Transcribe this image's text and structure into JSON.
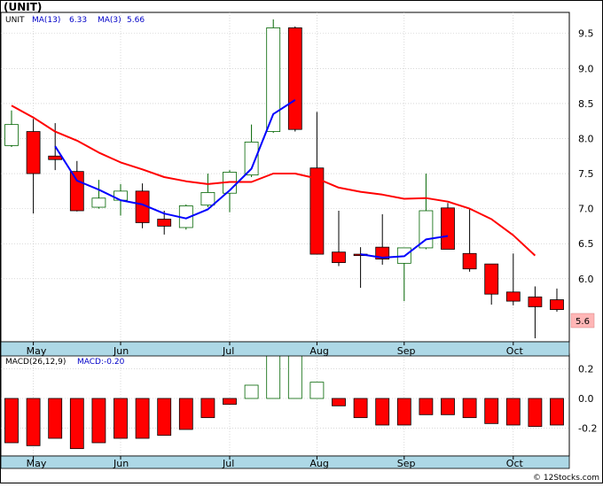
{
  "header": {
    "title": "(UNIT)"
  },
  "legend": {
    "symbol": "UNIT",
    "ma13_label": "MA(13)",
    "ma13_value": "6.33",
    "ma3_label": "MA(3)",
    "ma3_value": "5.66"
  },
  "macd_legend": {
    "label": "MACD(26,12,9)",
    "value_label": "MACD:-0.20"
  },
  "last_price_label": "5.6",
  "footer": {
    "copyright": "© 12Stocks.com"
  },
  "colors": {
    "up_candle": "#006400",
    "down_candle": "#ff0000",
    "ma3": "#0000ff",
    "ma13": "#ff0000",
    "axis_strip": "#add8e6",
    "grid": "#c0c0c0",
    "last_price_bg": "#ffb6b6"
  },
  "chart_data": [
    {
      "type": "candlestick",
      "title": "UNIT",
      "ylim": [
        5.1,
        9.8
      ],
      "yticks": [
        "6.0",
        "6.5",
        "7.0",
        "7.5",
        "8.0",
        "8.5",
        "9.0",
        "9.5"
      ],
      "xticks": [
        "May",
        "Jun",
        "Jul",
        "Aug",
        "Sep",
        "Oct"
      ],
      "xtick_index": [
        1,
        5,
        10,
        14,
        18,
        23
      ],
      "grid": true,
      "candles": [
        {
          "o": 7.9,
          "h": 8.4,
          "l": 7.88,
          "c": 8.2
        },
        {
          "o": 8.1,
          "h": 8.28,
          "l": 6.93,
          "c": 7.5
        },
        {
          "o": 7.75,
          "h": 8.22,
          "l": 7.55,
          "c": 7.7
        },
        {
          "o": 7.53,
          "h": 7.68,
          "l": 6.96,
          "c": 6.97
        },
        {
          "o": 7.02,
          "h": 7.41,
          "l": 7.0,
          "c": 7.15
        },
        {
          "o": 7.12,
          "h": 7.35,
          "l": 6.9,
          "c": 7.25
        },
        {
          "o": 7.25,
          "h": 7.36,
          "l": 6.72,
          "c": 6.8
        },
        {
          "o": 6.85,
          "h": 6.97,
          "l": 6.63,
          "c": 6.75
        },
        {
          "o": 6.73,
          "h": 7.06,
          "l": 6.7,
          "c": 7.04
        },
        {
          "o": 7.05,
          "h": 7.5,
          "l": 7.02,
          "c": 7.23
        },
        {
          "o": 7.22,
          "h": 7.55,
          "l": 6.95,
          "c": 7.52
        },
        {
          "o": 7.48,
          "h": 8.2,
          "l": 7.45,
          "c": 7.95
        },
        {
          "o": 8.1,
          "h": 9.7,
          "l": 8.08,
          "c": 9.58
        },
        {
          "o": 9.58,
          "h": 9.6,
          "l": 8.1,
          "c": 8.13
        },
        {
          "o": 7.58,
          "h": 8.38,
          "l": 6.35,
          "c": 6.35
        },
        {
          "o": 6.38,
          "h": 6.97,
          "l": 6.18,
          "c": 6.23
        },
        {
          "o": 6.35,
          "h": 6.45,
          "l": 5.87,
          "c": 6.33
        },
        {
          "o": 6.45,
          "h": 6.92,
          "l": 6.2,
          "c": 6.28
        },
        {
          "o": 6.22,
          "h": 6.44,
          "l": 5.68,
          "c": 6.44
        },
        {
          "o": 6.44,
          "h": 7.5,
          "l": 6.42,
          "c": 6.97
        },
        {
          "o": 7.01,
          "h": 7.08,
          "l": 6.42,
          "c": 6.42
        },
        {
          "o": 6.36,
          "h": 6.99,
          "l": 6.1,
          "c": 6.14
        },
        {
          "o": 6.21,
          "h": 6.21,
          "l": 5.63,
          "c": 5.78
        },
        {
          "o": 5.81,
          "h": 6.36,
          "l": 5.62,
          "c": 5.68
        },
        {
          "o": 5.74,
          "h": 5.89,
          "l": 5.15,
          "c": 5.6
        },
        {
          "o": 5.7,
          "h": 5.86,
          "l": 5.53,
          "c": 5.56
        }
      ],
      "series": [
        {
          "name": "MA(3)",
          "values": [
            null,
            null,
            7.89,
            7.4,
            7.27,
            7.12,
            7.06,
            6.93,
            6.86,
            6.99,
            7.26,
            7.57,
            8.35,
            8.55,
            null,
            null,
            6.35,
            6.3,
            6.32,
            6.56,
            6.61,
            null,
            null,
            null,
            null,
            null
          ]
        },
        {
          "name": "MA(13)",
          "values": [
            8.47,
            8.3,
            8.1,
            7.97,
            7.8,
            7.66,
            7.56,
            7.45,
            7.39,
            7.35,
            7.38,
            7.38,
            7.5,
            7.5,
            7.43,
            7.3,
            7.24,
            7.2,
            7.14,
            7.15,
            7.1,
            7.0,
            6.85,
            6.62,
            6.33,
            null
          ]
        }
      ]
    },
    {
      "type": "bar",
      "title": "MACD(26,12,9)",
      "ylim": [
        -0.39,
        0.3
      ],
      "yticks": [
        "0.2",
        "0.0",
        "-0.2"
      ],
      "xticks": [
        "May",
        "Jun",
        "Jul",
        "Aug",
        "Sep",
        "Oct"
      ],
      "values": [
        -0.3,
        -0.32,
        -0.27,
        -0.34,
        -0.3,
        -0.27,
        -0.27,
        -0.25,
        -0.21,
        -0.13,
        -0.04,
        0.09,
        0.3,
        0.29,
        0.11,
        -0.05,
        -0.13,
        -0.18,
        -0.18,
        -0.11,
        -0.11,
        -0.13,
        -0.17,
        -0.18,
        -0.19,
        -0.18
      ]
    }
  ]
}
